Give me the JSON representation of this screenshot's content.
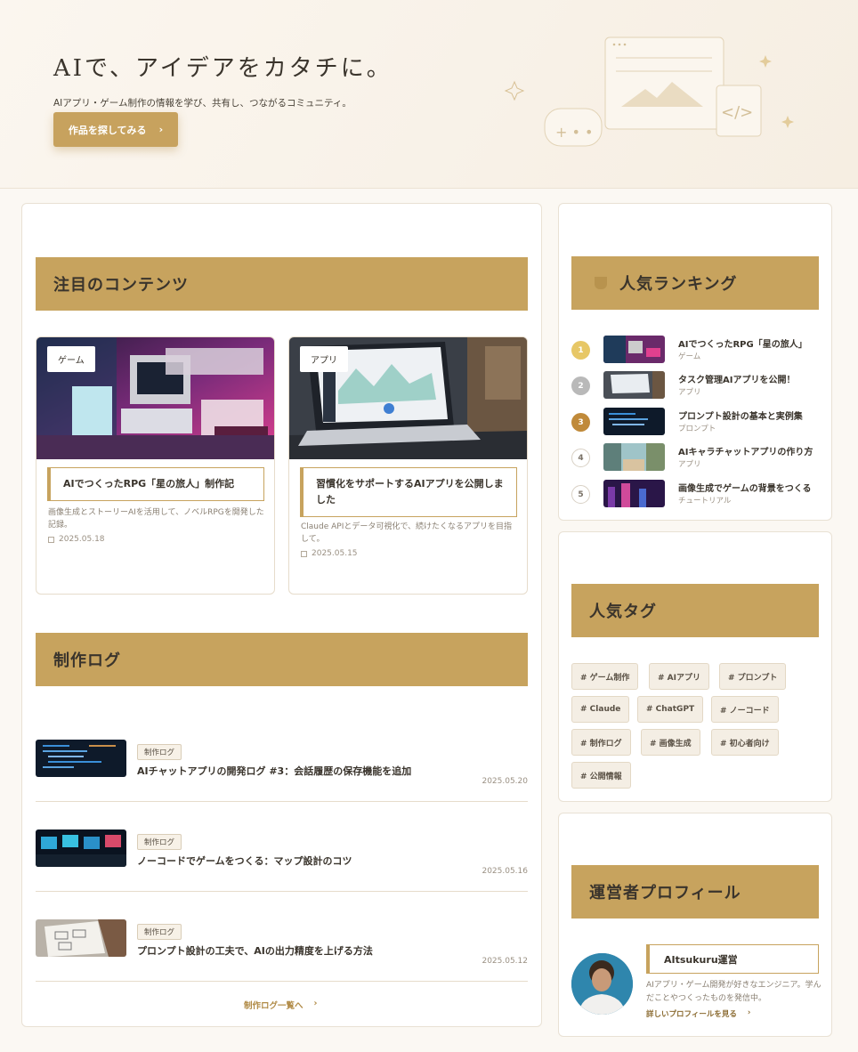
{
  "hero": {
    "title": "AIで、アイデアをカタチに。",
    "subtitle": "AIアプリ・ゲーム制作の情報を学び、共有し、つながるコミュニティ。",
    "cta_label": "作品を探してみる",
    "cta_chevron": "›",
    "illustration_chat_text": "+ • •",
    "illustration_code_text": "</>"
  },
  "featured": {
    "heading": "注目のコンテンツ",
    "items": [
      {
        "category": "ゲーム",
        "title": "AIでつくったRPG「星の旅人」制作記",
        "description": "画像生成とストーリーAIを活用して、ノベルRPGを開発した記録。",
        "date": "2025.05.18"
      },
      {
        "category": "アプリ",
        "title": "習慣化をサポートするAIアプリを公開しました",
        "description": "Claude APIとデータ可視化で、続けたくなるアプリを目指して。",
        "date": "2025.05.15"
      }
    ]
  },
  "devlog": {
    "heading": "制作ログ",
    "items": [
      {
        "badge": "制作ログ",
        "title": "AIチャットアプリの開発ログ #3：会話履歴の保存機能を追加",
        "date": "2025.05.20"
      },
      {
        "badge": "制作ログ",
        "title": "ノーコードでゲームをつくる：マップ設計のコツ",
        "date": "2025.05.16"
      },
      {
        "badge": "制作ログ",
        "title": "プロンプト設計の工夫で、AIの出力精度を上げる方法",
        "date": "2025.05.12"
      }
    ],
    "more_label": "制作ログ一覧へ",
    "more_chevron": "›"
  },
  "ranking": {
    "heading": "人気ランキング",
    "items": [
      {
        "rank": "1",
        "title": "AIでつくったRPG「星の旅人」",
        "category": "ゲーム",
        "color": "#e7c766"
      },
      {
        "rank": "2",
        "title": "タスク管理AIアプリを公開！",
        "category": "アプリ",
        "color": "#b9b9b9"
      },
      {
        "rank": "3",
        "title": "プロンプト設計の基本と実例集",
        "category": "プロンプト",
        "color": "#c08a3a"
      },
      {
        "rank": "4",
        "title": "AIキャラチャットアプリの作り方",
        "category": "アプリ",
        "color": "#ffffff"
      },
      {
        "rank": "5",
        "title": "画像生成でゲームの背景をつくる",
        "category": "チュートリアル",
        "color": "#ffffff"
      }
    ]
  },
  "tags": {
    "heading": "人気タグ",
    "items": [
      "# ゲーム制作",
      "# AIアプリ",
      "# プロンプト",
      "# Claude",
      "# ChatGPT",
      "# ノーコード",
      "# 制作ログ",
      "# 画像生成",
      "# 初心者向け",
      "# 公開情報"
    ]
  },
  "profile": {
    "heading": "運営者プロフィール",
    "name": "AItsukuru運営",
    "description": "AIアプリ・ゲーム開発が好きなエンジニア。学んだことやつくったものを発信中。",
    "link_label": "詳しいプロフィールを見る",
    "link_chevron": "›"
  },
  "colors": {
    "accent": "#c7a35e",
    "background": "#fbf8f3",
    "text": "#3a342c"
  }
}
